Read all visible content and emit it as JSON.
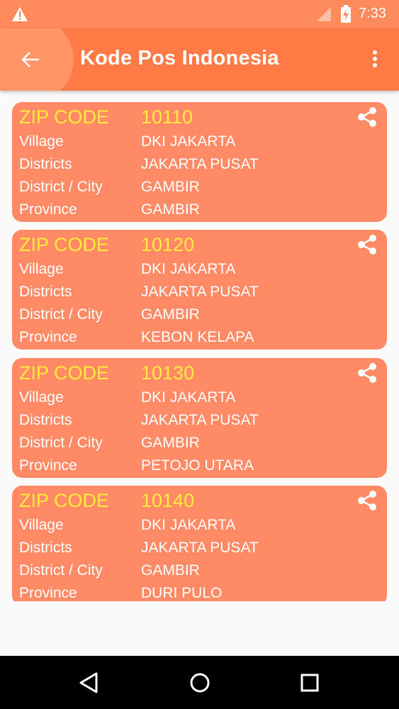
{
  "status_bar": {
    "time": "7:33",
    "icons": [
      "warning-icon",
      "signal-icon",
      "battery-charging-icon"
    ]
  },
  "app_bar": {
    "title": "Kode Pos Indonesia",
    "icons": [
      "back-arrow-icon",
      "more-vert-icon"
    ]
  },
  "colors": {
    "app_bar": "#ff7a45",
    "status_bar": "#ff8a5c",
    "card": "#ff8a65",
    "zip_text": "#ffeb3b",
    "text": "#ffffff"
  },
  "labels": {
    "zip_code": "ZIP CODE",
    "village": "Village",
    "districts": "Districts",
    "district_city": "District / City",
    "province": "Province"
  },
  "cards": [
    {
      "zip": "10110",
      "village": "DKI JAKARTA",
      "districts": "JAKARTA PUSAT",
      "district_city": "GAMBIR",
      "province": "GAMBIR"
    },
    {
      "zip": "10120",
      "village": "DKI JAKARTA",
      "districts": "JAKARTA PUSAT",
      "district_city": "GAMBIR",
      "province": "KEBON KELAPA"
    },
    {
      "zip": "10130",
      "village": "DKI JAKARTA",
      "districts": "JAKARTA PUSAT",
      "district_city": "GAMBIR",
      "province": "PETOJO UTARA"
    },
    {
      "zip": "10140",
      "village": "DKI JAKARTA",
      "districts": "JAKARTA PUSAT",
      "district_city": "GAMBIR",
      "province": "DURI PULO"
    }
  ],
  "nav_bar": {
    "icons": [
      "back-triangle-icon",
      "home-circle-icon",
      "recents-square-icon"
    ]
  }
}
